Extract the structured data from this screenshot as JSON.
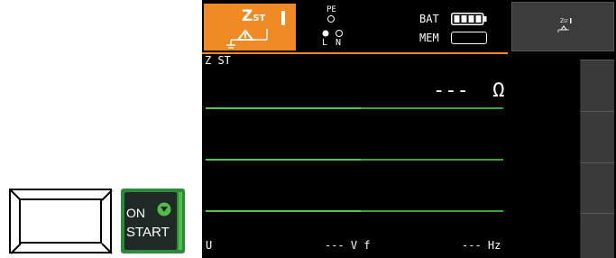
{
  "keypad": {
    "start_button": {
      "on_label": "ON",
      "start_label": "START",
      "icon": "arrow-down-icon"
    }
  },
  "screen": {
    "header": {
      "mode_symbol": "Z",
      "mode_subscript": "ST",
      "pe_label": "PE",
      "l_label": "L",
      "n_label": "N",
      "bat_label": "BAT",
      "mem_label": "MEM",
      "battery_level": 1.0
    },
    "softkey_top_label_main": "Z",
    "softkey_top_label_sub": "ST",
    "mode_text": "Z ST",
    "reading": {
      "value": "---",
      "unit": "Ω"
    },
    "footer": {
      "u_label": "U",
      "voltage_value": "---",
      "voltage_unit": "V",
      "f_label": "f",
      "freq_value": "---",
      "freq_unit": "Hz"
    },
    "colors": {
      "accent": "#f08a24",
      "trace": "#3da23a",
      "start_green": "#2e8a3a"
    }
  }
}
